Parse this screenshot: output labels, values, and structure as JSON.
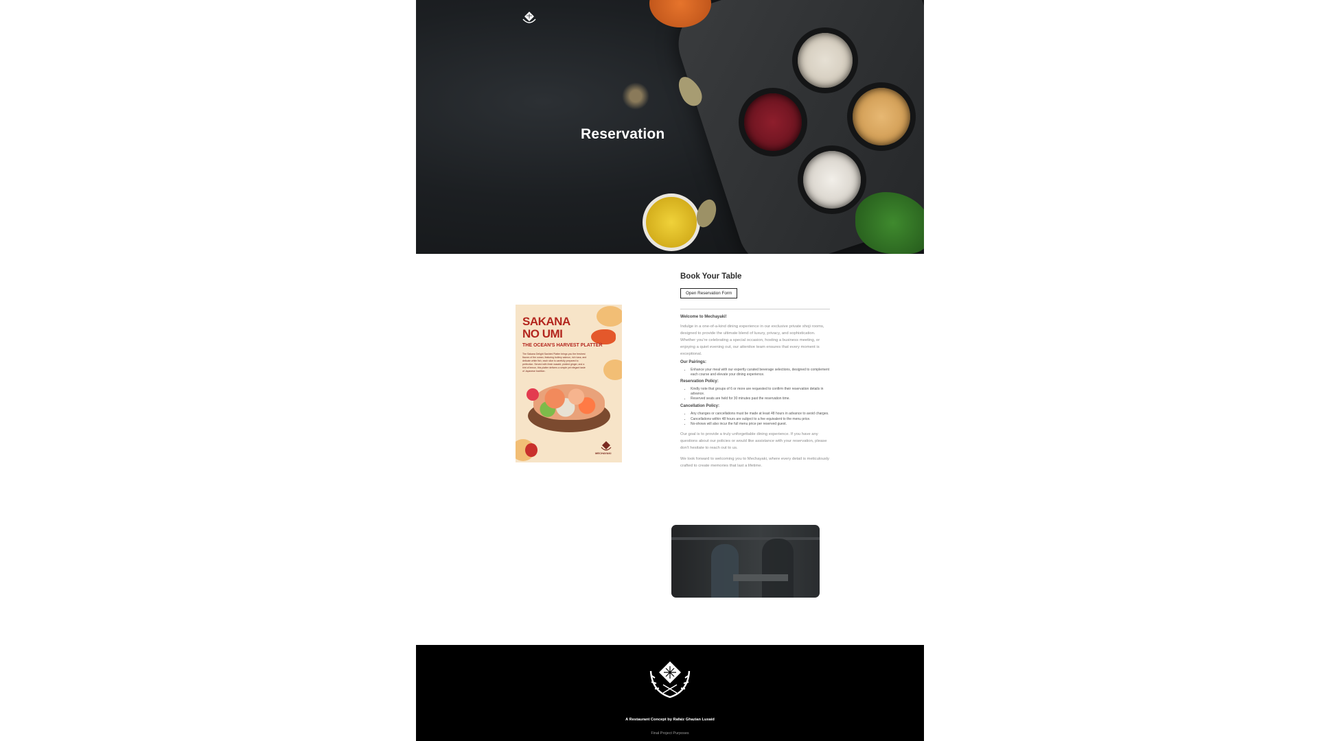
{
  "hero": {
    "title": "Reservation",
    "logo_icon": "restaurant-logo-icon"
  },
  "poster": {
    "title_line1": "SAKANA",
    "title_line2": "NO UMI",
    "subtitle": "THE OCEAN'S HARVEST PLATTER",
    "body": "The Sakana Delight Sashimi Platter brings you the freshest flavors of the ocean, featuring buttery salmon, rich tuna, and delicate white fish, each slice is carefully prepared to perfection. Served with fresh wasabi, pickled ginger, and a hint of lemon, this platter delivers a simple yet elegant taste of Japanese tradition.",
    "brand": "MECHAYAKI"
  },
  "book": {
    "title": "Book Your Table",
    "button_label": "Open Reservation Form",
    "welcome_heading": "Welcome to Mechayaki!",
    "intro": "Indulge in a one-of-a-kind dining experience in our exclusive private shoji rooms, designed to provide the ultimate blend of luxury, privacy, and sophistication. Whether you're celebrating a special occasion, hosting a business meeting, or enjoying a quiet evening out, our attentive team ensures that every moment is exceptional.",
    "pairings_heading": "Our Pairings:",
    "pairings": [
      "Enhance your meal with our expertly curated beverage selections, designed to complement each course and elevate your dining experience."
    ],
    "reservation_heading": "Reservation Policy:",
    "reservation_items": [
      "Kindly note that groups of 6 or more are requested to confirm their reservation details in advance.",
      "Reserved seats are held for 30 minutes past the reservation time."
    ],
    "cancellation_heading": "Cancellation Policy:",
    "cancellation_items": [
      "Any changes or cancellations must be made at least 48 hours in advance to avoid charges.",
      "Cancellations within 48 hours are subject to a fee equivalent to the menu price.",
      "No-shows will also incur the full menu price per reserved guest."
    ],
    "closing1": "Our goal is to provide a truly unforgettable dining experience. If you have any questions about our policies or would like assistance with your reservation, please don't hesitate to reach out to us.",
    "closing2": "We look forward to welcoming you to Mechayaki, where every detail is meticulously crafted to create memories that last a lifetime."
  },
  "footer": {
    "logo_icon": "footer-logo-icon",
    "credit": "A Restaurant Concept by Rafaiz Ghazian Luxaid",
    "note": "Final Project Purposes"
  }
}
